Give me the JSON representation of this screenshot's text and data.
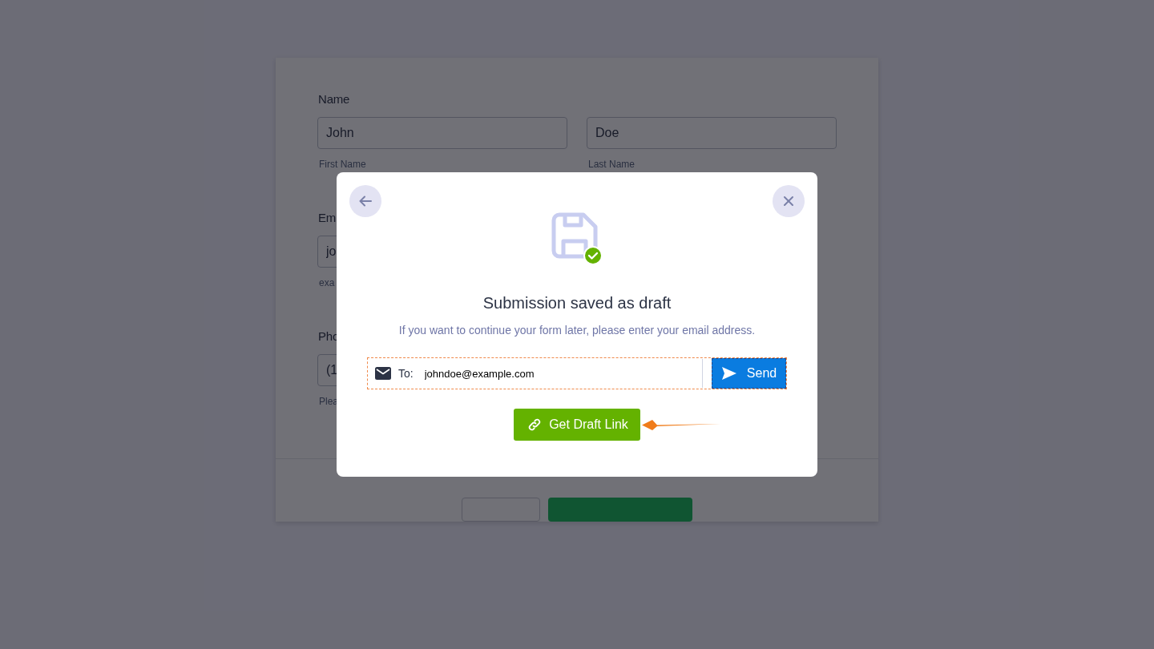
{
  "form": {
    "name_field": {
      "label": "Name",
      "first": {
        "value": "John",
        "sublabel": "First Name"
      },
      "last": {
        "value": "Doe",
        "sublabel": "Last Name"
      }
    },
    "email_field": {
      "label": "Em",
      "value": "jo",
      "sublabel": "exa"
    },
    "phone_field": {
      "label": "Pho",
      "value": "(1",
      "sublabel": "Plea"
    }
  },
  "modal": {
    "title": "Submission saved as draft",
    "message": "If you want to continue your form later, please enter your email address.",
    "email_row": {
      "label": "To:",
      "value": "johndoe@example.com"
    },
    "send_button": "Send",
    "draft_link_button": "Get Draft Link"
  }
}
